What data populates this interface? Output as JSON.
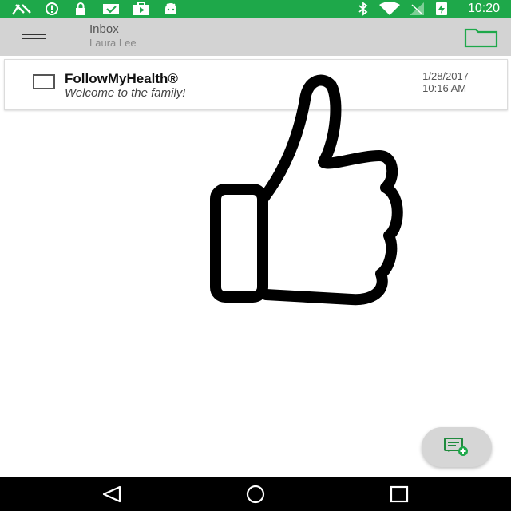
{
  "status_bar": {
    "time": "10:20",
    "left_icons": [
      "fax-icon",
      "alert-circle-icon",
      "lock-icon",
      "mail-check-icon",
      "briefcase-play-icon",
      "android-icon"
    ],
    "right_icons": [
      "bluetooth-icon",
      "wifi-icon",
      "no-signal-icon",
      "battery-charging-icon"
    ],
    "color": "#1ea84a"
  },
  "app_bar": {
    "title": "Inbox",
    "subtitle": "Laura Lee",
    "menu_icon": "hamburger-menu-icon",
    "folder_icon": "folder-icon"
  },
  "messages": [
    {
      "sender": "FollowMyHealth®",
      "preview": "Welcome to the family!",
      "date": "1/28/2017",
      "time": "10:16 AM"
    }
  ],
  "illustration": {
    "icon": "thumbs-up-icon"
  },
  "fab": {
    "icon": "compose-message-icon"
  },
  "nav_bar": {
    "icons": [
      "back-triangle-icon",
      "home-circle-icon",
      "recents-square-icon"
    ]
  },
  "colors": {
    "accent": "#1ea84a",
    "app_bar_bg": "#d3d3d3"
  }
}
